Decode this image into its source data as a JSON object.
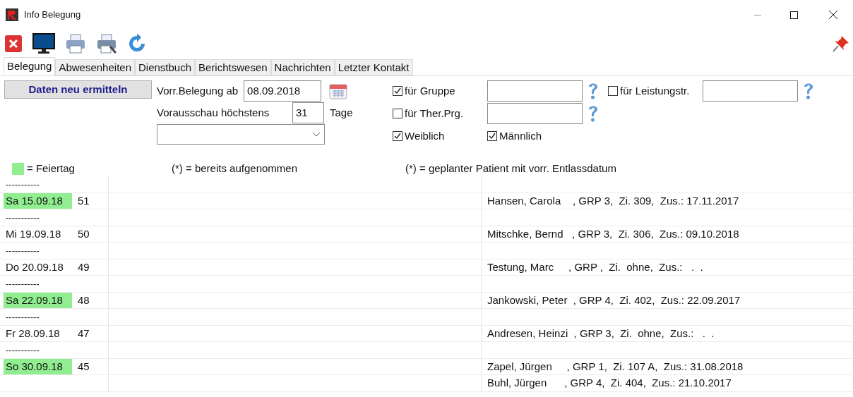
{
  "window": {
    "title": "Info Belegung"
  },
  "tabs": [
    {
      "label": "Belegung",
      "selected": true
    },
    {
      "label": "Abwesenheiten",
      "selected": false
    },
    {
      "label": "Dienstbuch",
      "selected": false
    },
    {
      "label": "Berichtswesen",
      "selected": false
    },
    {
      "label": "Nachrichten",
      "selected": false
    },
    {
      "label": "Letzter Kontakt",
      "selected": false
    }
  ],
  "refresh_button": "Daten neu ermitteln",
  "start": {
    "label": "Vorr.Belegung ab",
    "value": "08.09.2018"
  },
  "preview": {
    "label": "Vorausschau höchstens",
    "value": "31",
    "unit": "Tage"
  },
  "filters": [
    {
      "label": "für Gruppe",
      "checked": true
    },
    {
      "label": "für Leistungstr.",
      "checked": false
    },
    {
      "label": "für Ther.Prg.",
      "checked": false
    }
  ],
  "gender": [
    {
      "label": "Weiblich",
      "checked": true
    },
    {
      "label": "Männlich",
      "checked": true
    }
  ],
  "legend": {
    "holiday": "= Feiertag",
    "admitted": "(*) = bereits aufgenommen",
    "planned": "(*) = geplanter Patient mit vorr. Entlassdatum"
  },
  "rows": [
    {
      "kind": "dashes",
      "text": "-----------"
    },
    {
      "kind": "day",
      "date": "Sa 15.09.18",
      "count": "51",
      "holiday": true,
      "patient": "Hansen, Carola    , GRP 3,  Zi. 309,  Zus.: 17.11.2017"
    },
    {
      "kind": "dashes",
      "text": "-----------"
    },
    {
      "kind": "day",
      "date": "Mi 19.09.18",
      "count": "50",
      "holiday": false,
      "patient": "Mitschke, Bernd   , GRP 3,  Zi. 306,  Zus.: 09.10.2018"
    },
    {
      "kind": "dashes",
      "text": "-----------"
    },
    {
      "kind": "day",
      "date": "Do 20.09.18",
      "count": "49",
      "holiday": false,
      "patient": "Testung, Marc     , GRP ,  Zi.  ohne,  Zus.:   .  ."
    },
    {
      "kind": "dashes",
      "text": "-----------"
    },
    {
      "kind": "day",
      "date": "Sa 22.09.18",
      "count": "48",
      "holiday": true,
      "patient": "Jankowski, Peter  , GRP 4,  Zi. 402,  Zus.: 22.09.2017"
    },
    {
      "kind": "dashes",
      "text": "-----------"
    },
    {
      "kind": "day",
      "date": "Fr 28.09.18",
      "count": "47",
      "holiday": false,
      "patient": "Andresen, Heinzi  , GRP 3,  Zi.  ohne,  Zus.:   .  ."
    },
    {
      "kind": "dashes",
      "text": "-----------"
    },
    {
      "kind": "day",
      "date": "So 30.09.18",
      "count": "45",
      "holiday": true,
      "patient": "Zapel, Jürgen     , GRP 1,  Zi. 107 A,  Zus.: 31.08.2018"
    },
    {
      "kind": "more",
      "patient": "Buhl, Jürgen      , GRP 4,  Zi. 404,  Zus.: 21.10.2017"
    }
  ]
}
